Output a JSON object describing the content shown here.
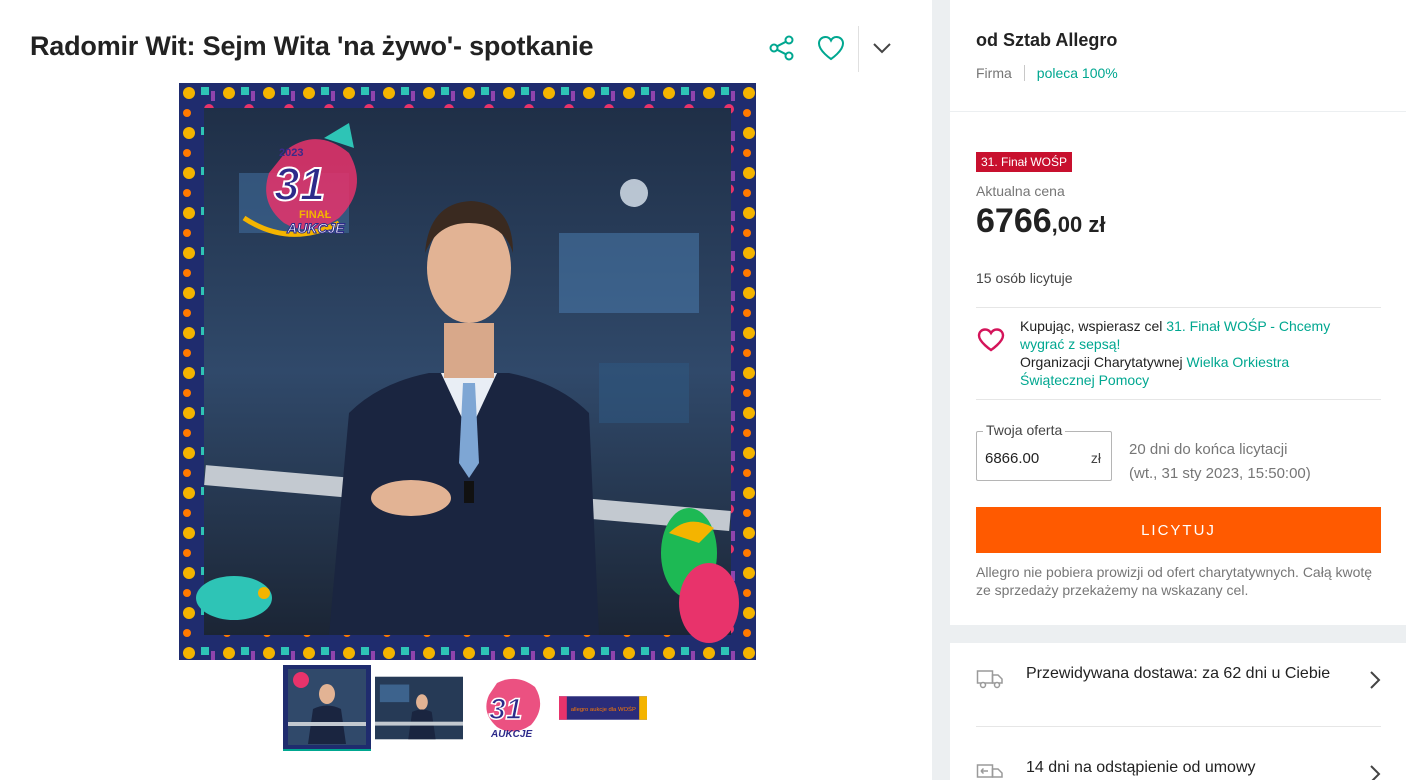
{
  "product": {
    "title": "Radomir Wit: Sejm Wita 'na żywo'- spotkanie"
  },
  "colors": {
    "accent": "#00a790",
    "button": "#ff5a00",
    "badge": "#c8102e"
  },
  "icons": [
    "share-icon",
    "heart-icon",
    "chevron-down-icon",
    "charity-heart-icon",
    "truck-icon",
    "return-icon",
    "chevron-right-icon"
  ],
  "seller": {
    "name": "od Sztab Allegro",
    "type": "Firma",
    "recommend": "poleca 100%"
  },
  "offer": {
    "badge": "31. Finał WOŚP",
    "price_label": "Aktualna cena",
    "price_int": "6766",
    "price_dec": ",00 zł",
    "bidders": "15 osób licytuje",
    "charity_prefix": "Kupując, wspierasz cel ",
    "charity_goal": "31. Finał WOŚP - Chcemy wygrać z sepsą!",
    "charity_org_prefix": "Organizacji Charytatywnej ",
    "charity_org": "Wielka Orkiestra Świątecznej Pomocy",
    "bid_label": "Twoja oferta",
    "bid_value": "6866.00",
    "bid_currency": "zł",
    "time_left": "20 dni do końca licytacji",
    "end_date": "(wt., 31 sty 2023, 15:50:00)",
    "bid_button": "LICYTUJ",
    "note": "Allegro nie pobiera prowizji od ofert charytatywnych. Całą kwotę ze sprzedaży przekażemy na wskazany cel."
  },
  "delivery": {
    "shipping": "Przewidywana dostawa: za 62 dni u Ciebie",
    "returns": "14 dni na odstąpienie od umowy"
  },
  "image": {
    "logo_number": "31",
    "logo_year": "2023",
    "logo_line1": "FINAŁ",
    "logo_line2": "AUKCJE",
    "banner_text": "allegro  aukcje dla WOŚP"
  }
}
